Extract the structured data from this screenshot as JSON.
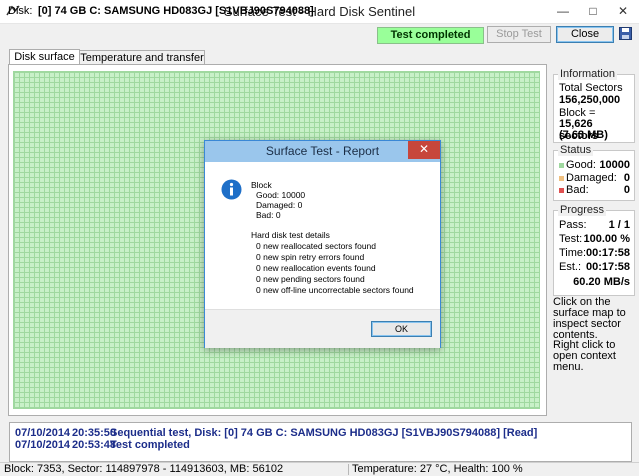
{
  "window": {
    "title": "Surface Test - Hard Disk Sentinel"
  },
  "toolbar": {
    "disk_label": "Disk:",
    "disk_name": "[0] 74 GB C: SAMSUNG HD083GJ [S1VBJ90S794088]",
    "status_text": "Test completed",
    "status_color": "#99ff99",
    "stop_label": "Stop Test",
    "close_label": "Close",
    "save_icon": "floppy-disk-icon"
  },
  "tabs": [
    {
      "label": "Disk surface map",
      "active": true
    },
    {
      "label": "Temperature and transfer speed",
      "active": false
    }
  ],
  "surface_map": {
    "block_color": "#c8f0c8",
    "good_blocks": 10000
  },
  "information": {
    "title": "Information",
    "total_sectors_label": "Total Sectors",
    "total_sectors_value": "156,250,000",
    "block_label": "Block =",
    "block_sectors": "15,626 sectors",
    "block_size": "(7.63 MB)"
  },
  "status": {
    "title": "Status",
    "good_label": "Good:",
    "good_value": "10000",
    "damaged_label": "Damaged:",
    "damaged_value": "0",
    "bad_label": "Bad:",
    "bad_value": "0",
    "colors": {
      "good": "#9fd89f",
      "damaged": "#f0c080",
      "bad": "#e05050"
    }
  },
  "progress": {
    "title": "Progress",
    "pass_label": "Pass:",
    "pass_value": "1 / 1",
    "test_label": "Test:",
    "test_value": "100.00 %",
    "time_label": "Time:",
    "time_value": "00:17:58",
    "est_label": "Est.:",
    "est_value": "00:17:58",
    "speed_value": "60.20 MB/s"
  },
  "hints": {
    "click_hint": "Click on the surface map to inspect sector contents.",
    "right_click_hint": "Right click to open context menu."
  },
  "log": [
    {
      "date": "07/10/2014",
      "time": "20:35:50",
      "message": "Sequential test, Disk: [0] 74 GB C: SAMSUNG HD083GJ [S1VBJ90S794088] [Read]"
    },
    {
      "date": "07/10/2014",
      "time": "20:53:48",
      "message": "Test completed"
    }
  ],
  "statusbar": {
    "position": "Block: 7353, Sector: 114897978 - 114913603, MB: 56102",
    "health": "Temperature: 27 °C,  Health: 100 %"
  },
  "dialog": {
    "title": "Surface Test - Report",
    "icon": "info-icon",
    "block_heading": "Block",
    "good": "Good: 10000",
    "damaged": "Damaged: 0",
    "bad": "Bad: 0",
    "details_heading": "Hard disk test details",
    "details": [
      "0 new reallocated sectors found",
      "0 new spin retry errors found",
      "0 new reallocation events found",
      "0 new pending sectors found",
      "0 new off-line uncorrectable sectors found"
    ],
    "ok_label": "OK"
  }
}
